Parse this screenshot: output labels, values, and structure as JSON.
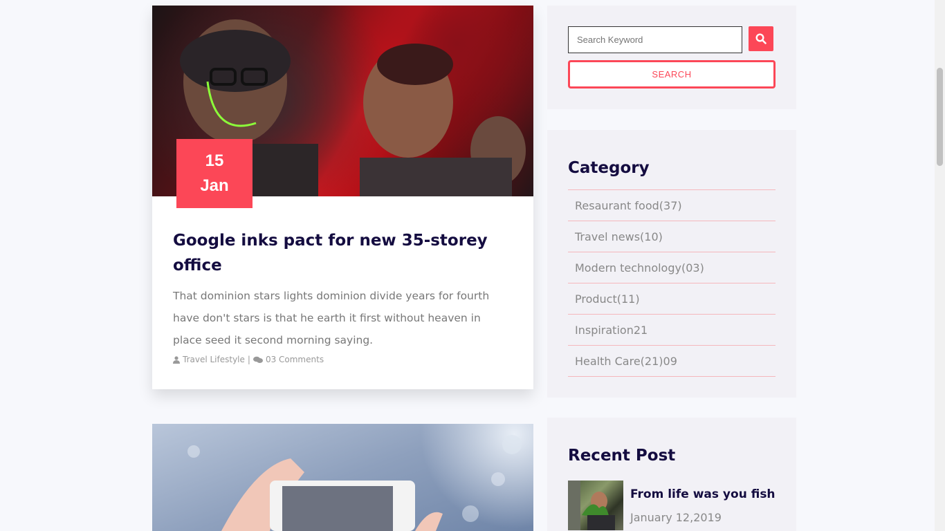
{
  "post": {
    "day": "15",
    "month": "Jan",
    "title": "Google inks pact for new 35-storey office",
    "excerpt": "That dominion stars lights dominion divide years for fourth have don't stars is that he earth it first without heaven in place seed it second morning saying.",
    "author": "Travel Lifestyle",
    "separator": "|",
    "comments": "03 Comments"
  },
  "search": {
    "placeholder": "Search Keyword",
    "button_label": "SEARCH"
  },
  "category": {
    "title": "Category",
    "items": [
      "Resaurant food(37)",
      "Travel news(10)",
      "Modern technology(03)",
      "Product(11)",
      "Inspiration21",
      "Health Care(21)09"
    ]
  },
  "recent": {
    "title": "Recent Post",
    "items": [
      {
        "title": "From life was you fish",
        "date": "January 12,2019"
      }
    ]
  },
  "colors": {
    "accent": "#fc4757",
    "heading": "#140c40",
    "text": "#777777"
  }
}
